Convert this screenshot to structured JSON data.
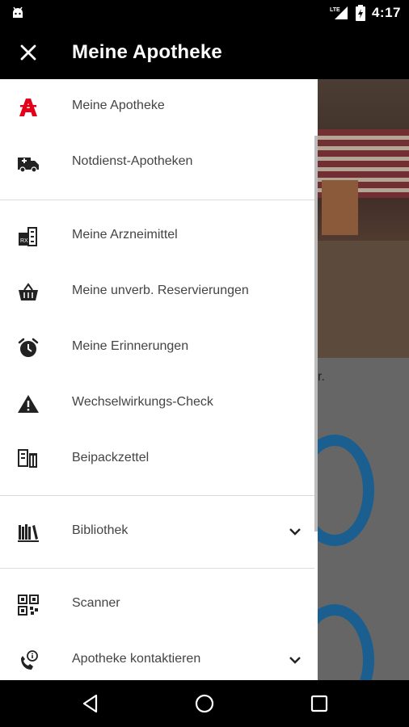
{
  "status_bar": {
    "time": "4:17",
    "network": "LTE"
  },
  "toolbar": {
    "title": "Meine Apotheke"
  },
  "drawer": {
    "groups": [
      {
        "items": [
          {
            "label": "Meine Apotheke",
            "icon": "apotheke-a-icon"
          },
          {
            "label": "Notdienst-Apotheken",
            "icon": "ambulance-icon"
          }
        ]
      },
      {
        "items": [
          {
            "label": "Meine Arzneimittel",
            "icon": "medication-icon"
          },
          {
            "label": "Meine unverb. Reservierungen",
            "icon": "basket-icon"
          },
          {
            "label": "Meine Erinnerungen",
            "icon": "alarm-clock-icon"
          },
          {
            "label": "Wechselwirkungs-Check",
            "icon": "warning-icon"
          },
          {
            "label": "Beipackzettel",
            "icon": "leaflet-icon"
          }
        ]
      },
      {
        "items": [
          {
            "label": "Bibliothek",
            "icon": "library-icon",
            "expandable": true
          }
        ]
      },
      {
        "items": [
          {
            "label": "Scanner",
            "icon": "qr-code-icon"
          },
          {
            "label": "Apotheke kontaktieren",
            "icon": "phone-info-icon",
            "expandable": true
          }
        ]
      }
    ]
  },
  "background": {
    "fragment_text": "r."
  },
  "colors": {
    "accent": "#e3001b",
    "drawer_bg": "#ffffff",
    "bar_bg": "#000000",
    "blue": "#1a5f8f"
  }
}
